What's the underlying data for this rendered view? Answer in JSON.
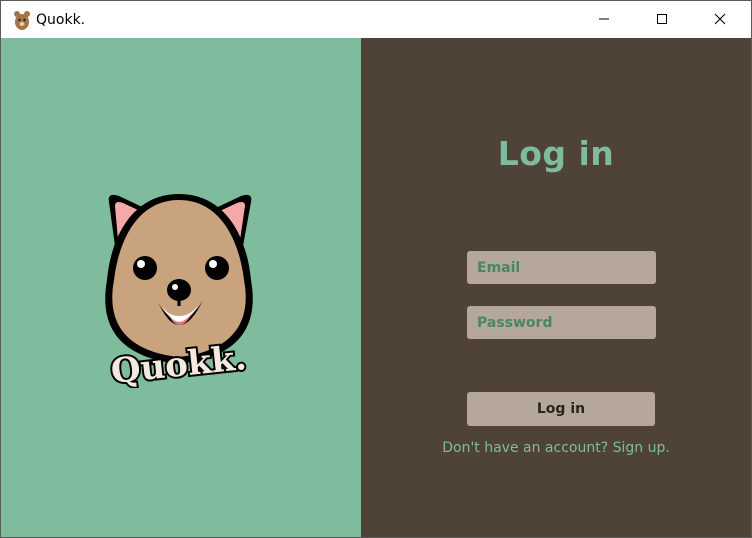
{
  "window": {
    "title": "Quokk.",
    "app_icon": "quokka-icon",
    "controls": {
      "minimize": "minimize-icon",
      "maximize": "maximize-icon",
      "close": "close-icon"
    }
  },
  "brand": {
    "logo_text": "Quokk.",
    "logo": "quokka-mascot-logo"
  },
  "login": {
    "heading": "Log in",
    "email_placeholder": "Email",
    "password_placeholder": "Password",
    "submit_label": "Log in",
    "signup_link": "Don't have an account? Sign up."
  },
  "colors": {
    "left_panel": "#7fbb9d",
    "right_panel": "#4e4336",
    "accent": "#7fbb9d",
    "field_bg": "#b5a799",
    "field_text": "#4a8567"
  }
}
